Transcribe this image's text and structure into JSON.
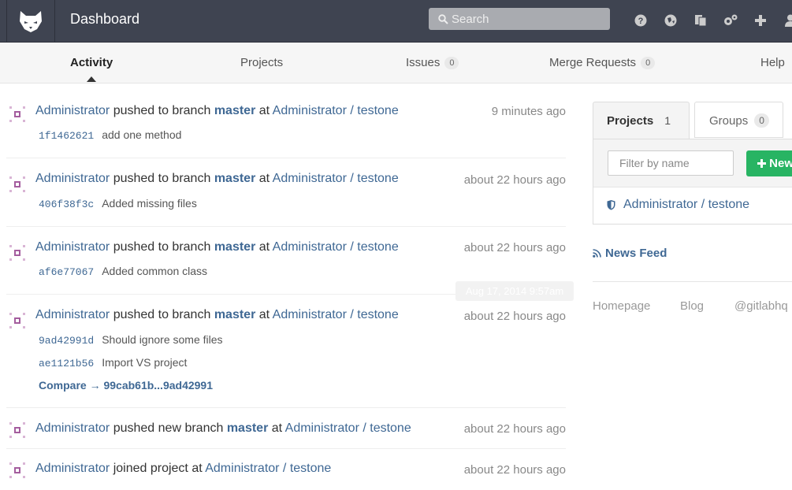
{
  "header": {
    "title": "Dashboard",
    "search_placeholder": "Search",
    "icons": [
      "help-icon",
      "globe-icon",
      "snippets-icon",
      "settings-icon",
      "plus-icon",
      "user-icon"
    ]
  },
  "nav": {
    "activity": "Activity",
    "projects": "Projects",
    "issues": "Issues",
    "issues_count": "0",
    "merge_requests": "Merge Requests",
    "merge_requests_count": "0",
    "help": "Help"
  },
  "events": [
    {
      "author": "Administrator",
      "action": "pushed to branch",
      "ref": "master",
      "at": "at",
      "project": "Administrator / testone",
      "time": "9 minutes ago",
      "commits": [
        {
          "sha": "1f1462621",
          "message": "add one method"
        }
      ]
    },
    {
      "author": "Administrator",
      "action": "pushed to branch",
      "ref": "master",
      "at": "at",
      "project": "Administrator / testone",
      "time": "about 22 hours ago",
      "commits": [
        {
          "sha": "406f38f3c",
          "message": "Added missing files"
        }
      ]
    },
    {
      "author": "Administrator",
      "action": "pushed to branch",
      "ref": "master",
      "at": "at",
      "project": "Administrator / testone",
      "time": "about 22 hours ago",
      "commits": [
        {
          "sha": "af6e77067",
          "message": "Added common class"
        }
      ]
    },
    {
      "author": "Administrator",
      "action": "pushed to branch",
      "ref": "master",
      "at": "at",
      "project": "Administrator / testone",
      "time": "about 22 hours ago",
      "commits": [
        {
          "sha": "9ad42991d",
          "message": "Should ignore some files"
        },
        {
          "sha": "ae1121b56",
          "message": "Import VS project"
        }
      ],
      "compare": "Compare → 99cab61b...9ad42991"
    },
    {
      "author": "Administrator",
      "action": "pushed new branch",
      "ref": "master",
      "at": "at",
      "project": "Administrator / testone",
      "time": "about 22 hours ago"
    },
    {
      "author": "Administrator",
      "action": "joined project",
      "at": "at",
      "project": "Administrator / testone",
      "time": "about 22 hours ago"
    }
  ],
  "tooltip": "Aug 17, 2014 9:57am",
  "sidebar": {
    "tab_projects": "Projects",
    "tab_projects_count": "1",
    "tab_groups": "Groups",
    "tab_groups_count": "0",
    "filter_placeholder": "Filter by name",
    "new_button": "New",
    "project": "Administrator / testone",
    "news_feed": "News Feed",
    "footer": {
      "homepage": "Homepage",
      "blog": "Blog",
      "twitter": "@gitlabhq"
    }
  },
  "colors": {
    "header_bg": "#3f4451",
    "link": "#3f6894",
    "new_button": "#28b463"
  }
}
